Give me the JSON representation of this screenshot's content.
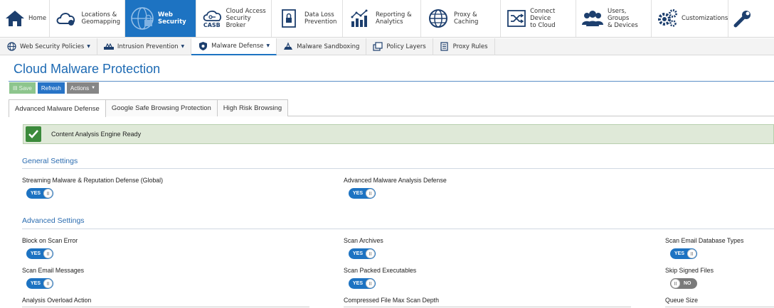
{
  "nav": {
    "items": [
      {
        "label": "Home",
        "icon": "home-icon"
      },
      {
        "label": "Locations &\nGeomapping",
        "icon": "cloud-location-icon"
      },
      {
        "label": "Web Security",
        "icon": "globe-lock-icon",
        "active": true
      },
      {
        "label": "Cloud Access\nSecurity Broker",
        "icon": "casb-icon"
      },
      {
        "label": "Data Loss\nPrevention",
        "icon": "dlp-lock-icon"
      },
      {
        "label": "Reporting &\nAnalytics",
        "icon": "analytics-icon"
      },
      {
        "label": "Proxy &\nCaching",
        "icon": "proxy-globe-icon"
      },
      {
        "label": "Connect Device\nto Cloud",
        "icon": "connect-device-icon"
      },
      {
        "label": "Users, Groups\n& Devices",
        "icon": "users-icon"
      },
      {
        "label": "Customizations",
        "icon": "gears-icon"
      },
      {
        "label": "",
        "icon": "wrench-icon"
      }
    ],
    "casb_text": "CASB"
  },
  "subnav": {
    "items": [
      {
        "label": "Web Security Policies",
        "icon": "globe-policy-icon",
        "dropdown": true
      },
      {
        "label": "Intrusion Prevention",
        "icon": "intrusion-icon",
        "dropdown": true
      },
      {
        "label": "Malware Defense",
        "icon": "shield-bug-icon",
        "dropdown": true,
        "active": true
      },
      {
        "label": "Malware Sandboxing",
        "icon": "sandbox-icon",
        "dropdown": false
      },
      {
        "label": "Policy Layers",
        "icon": "layers-icon",
        "dropdown": false
      },
      {
        "label": "Proxy Rules",
        "icon": "proxy-rules-icon",
        "dropdown": false
      }
    ]
  },
  "page": {
    "title": "Cloud Malware Protection"
  },
  "toolbar": {
    "save_label": "Save",
    "refresh_label": "Refresh",
    "actions_label": "Actions"
  },
  "tabs": [
    {
      "label": "Advanced Malware Defense",
      "active": true
    },
    {
      "label": "Google Safe Browsing Protection",
      "active": false
    },
    {
      "label": "High Risk Browsing",
      "active": false
    }
  ],
  "banner": {
    "text": "Content Analysis Engine Ready"
  },
  "general": {
    "title": "General Settings",
    "fields": [
      {
        "label": "Streaming Malware & Reputation Defense (Global)",
        "value": "YES"
      },
      {
        "label": "Advanced Malware Analysis Defense",
        "value": "YES"
      }
    ]
  },
  "advanced": {
    "title": "Advanced Settings",
    "fields": [
      {
        "label": "Block on Scan Error",
        "value": "YES"
      },
      {
        "label": "Scan Archives",
        "value": "YES"
      },
      {
        "label": "Scan Email Database Types",
        "value": "YES"
      },
      {
        "label": "Scan Email Messages",
        "value": "YES"
      },
      {
        "label": "Scan Packed Executables",
        "value": "YES"
      },
      {
        "label": "Skip Signed Files",
        "value": "NO"
      },
      {
        "label": "Analysis Overload Action",
        "value": ""
      },
      {
        "label": "Compressed File Max Scan Depth",
        "value": ""
      },
      {
        "label": "Queue Size",
        "value": ""
      }
    ]
  },
  "colors": {
    "accent": "#1d73c2",
    "banner_bg": "#dfe9d8",
    "success": "#3b8a3b",
    "title": "#1d6ab3"
  }
}
